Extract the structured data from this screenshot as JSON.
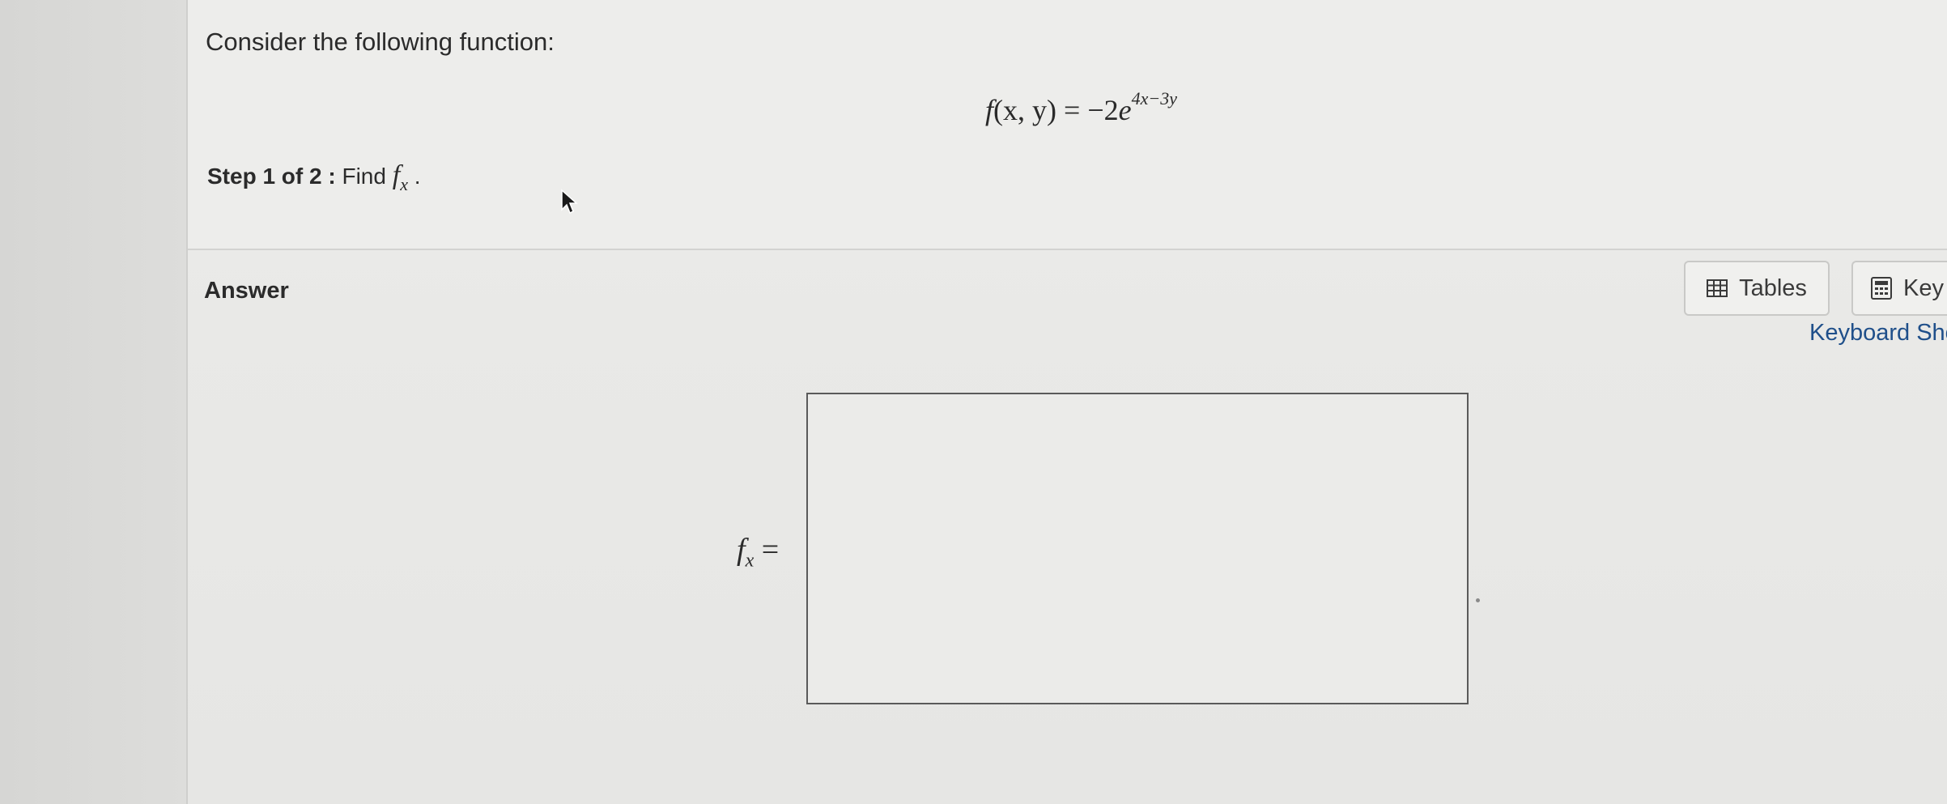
{
  "question": {
    "prompt": "Consider the following function:",
    "formula": {
      "lhs_func": "f",
      "lhs_args": "(x, y)",
      "equals": "=",
      "coefficient": "−2",
      "base": "e",
      "exponent": "4x−3y"
    },
    "step": {
      "label": "Step 1 of 2 :",
      "instruction": "Find",
      "var": "f",
      "sub": "x",
      "end": "."
    }
  },
  "answer": {
    "label": "Answer",
    "fx_var": "f",
    "fx_sub": "x",
    "fx_equals": "=",
    "input_value": ""
  },
  "toolbar": {
    "tables_label": "Tables",
    "keypad_label": "Key",
    "shortcuts_label": "Keyboard Sho"
  },
  "icons": {
    "tables": "table-grid-icon",
    "keypad": "calculator-icon",
    "cursor": "mouse-pointer-icon"
  }
}
